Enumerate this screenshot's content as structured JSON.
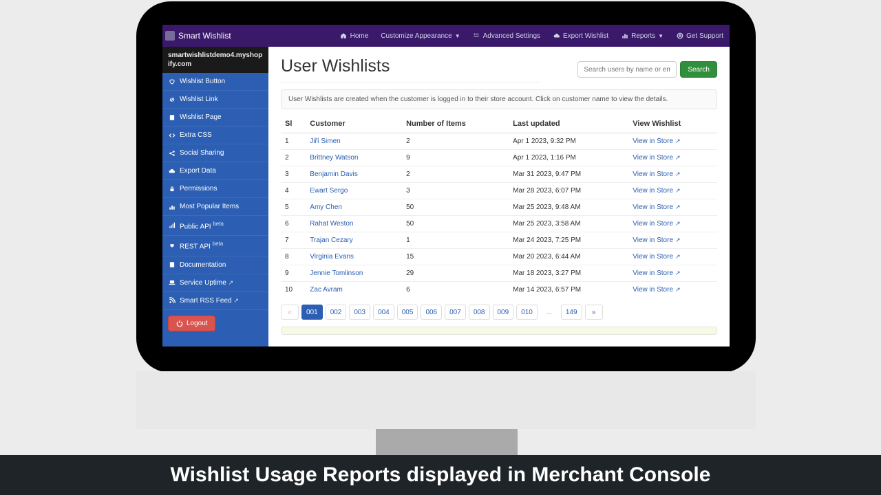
{
  "caption": "Wishlist Usage Reports displayed in Merchant Console",
  "nav": {
    "brand": "Smart Wishlist",
    "items": [
      "Home",
      "Customize Appearance",
      "Advanced Settings",
      "Export Wishlist",
      "Reports",
      "Get Support"
    ]
  },
  "sidebar": {
    "shop": "smartwishlistdemo4.myshopify.com",
    "items": [
      {
        "icon": "heart",
        "label": "Wishlist Button"
      },
      {
        "icon": "link",
        "label": "Wishlist Link"
      },
      {
        "icon": "page",
        "label": "Wishlist Page"
      },
      {
        "icon": "code",
        "label": "Extra CSS"
      },
      {
        "icon": "share",
        "label": "Social Sharing"
      },
      {
        "icon": "cloud",
        "label": "Export Data"
      },
      {
        "icon": "lock",
        "label": "Permissions"
      },
      {
        "icon": "chart",
        "label": "Most Popular Items"
      },
      {
        "icon": "signal",
        "label": "Public API",
        "beta": true
      },
      {
        "icon": "plug",
        "label": "REST API",
        "beta": true
      },
      {
        "icon": "book",
        "label": "Documentation"
      },
      {
        "icon": "laptop",
        "label": "Service Uptime",
        "ext": true
      },
      {
        "icon": "rss",
        "label": "Smart RSS Feed",
        "ext": true
      }
    ],
    "logout": "Logout",
    "beta_badge": "beta"
  },
  "main": {
    "title": "User Wishlists",
    "search_placeholder": "Search users by name or email",
    "search_button": "Search",
    "info": "User Wishlists are created when the customer is logged in to their store account. Click on customer name to view the details.",
    "columns": [
      "Sl",
      "Customer",
      "Number of Items",
      "Last updated",
      "View Wishlist"
    ],
    "view_label": "View in Store",
    "rows": [
      {
        "sl": 1,
        "customer": "Jiří Simen",
        "items": 2,
        "updated": "Apr 1 2023, 9:32 PM"
      },
      {
        "sl": 2,
        "customer": "Brittney Watson",
        "items": 9,
        "updated": "Apr 1 2023, 1:16 PM"
      },
      {
        "sl": 3,
        "customer": "Benjamin Davis",
        "items": 2,
        "updated": "Mar 31 2023, 9:47 PM"
      },
      {
        "sl": 4,
        "customer": "Ewart Sergo",
        "items": 3,
        "updated": "Mar 28 2023, 6:07 PM"
      },
      {
        "sl": 5,
        "customer": "Amy Chen",
        "items": 50,
        "updated": "Mar 25 2023, 9:48 AM"
      },
      {
        "sl": 6,
        "customer": "Rahat Weston",
        "items": 50,
        "updated": "Mar 25 2023, 3:58 AM"
      },
      {
        "sl": 7,
        "customer": "Trajan Cezary",
        "items": 1,
        "updated": "Mar 24 2023, 7:25 PM"
      },
      {
        "sl": 8,
        "customer": "Virginia Evans",
        "items": 15,
        "updated": "Mar 20 2023, 6:44 AM"
      },
      {
        "sl": 9,
        "customer": "Jennie Tomlinson",
        "items": 29,
        "updated": "Mar 18 2023, 3:27 PM"
      },
      {
        "sl": 10,
        "customer": "Zac Avram",
        "items": 6,
        "updated": "Mar 14 2023, 6:57 PM"
      }
    ],
    "pages": [
      "«",
      "001",
      "002",
      "003",
      "004",
      "005",
      "006",
      "007",
      "008",
      "009",
      "010",
      "...",
      "149",
      "»"
    ],
    "active_page": "001"
  }
}
